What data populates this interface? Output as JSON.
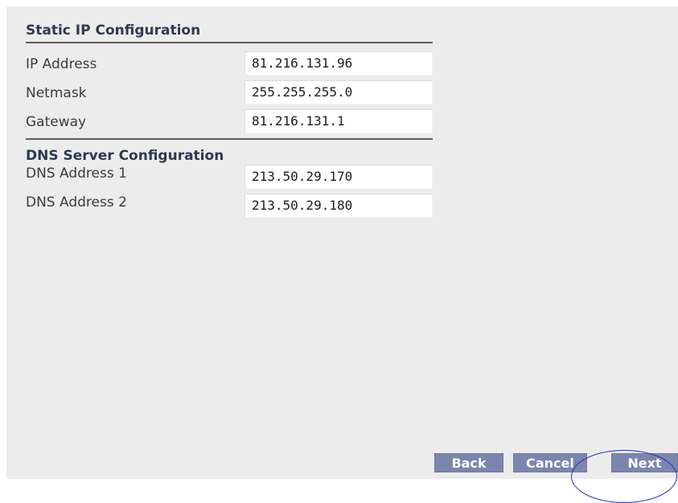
{
  "static_ip": {
    "title": "Static IP Configuration",
    "fields": [
      {
        "label": "IP Address",
        "value": "81.216.131.96"
      },
      {
        "label": "Netmask",
        "value": "255.255.255.0"
      },
      {
        "label": "Gateway",
        "value": "81.216.131.1"
      }
    ]
  },
  "dns": {
    "title": "DNS Server Configuration",
    "fields": [
      {
        "label": "DNS Address 1",
        "value": "213.50.29.170"
      },
      {
        "label": "DNS Address 2",
        "value": "213.50.29.180"
      }
    ]
  },
  "buttons": {
    "back": "Back",
    "cancel": "Cancel",
    "next": "Next"
  },
  "colors": {
    "panel_background": "#ececec",
    "section_title": "#2d3a52",
    "button_background": "#7b86ad",
    "annotation_ellipse": "#1f2bd1"
  }
}
